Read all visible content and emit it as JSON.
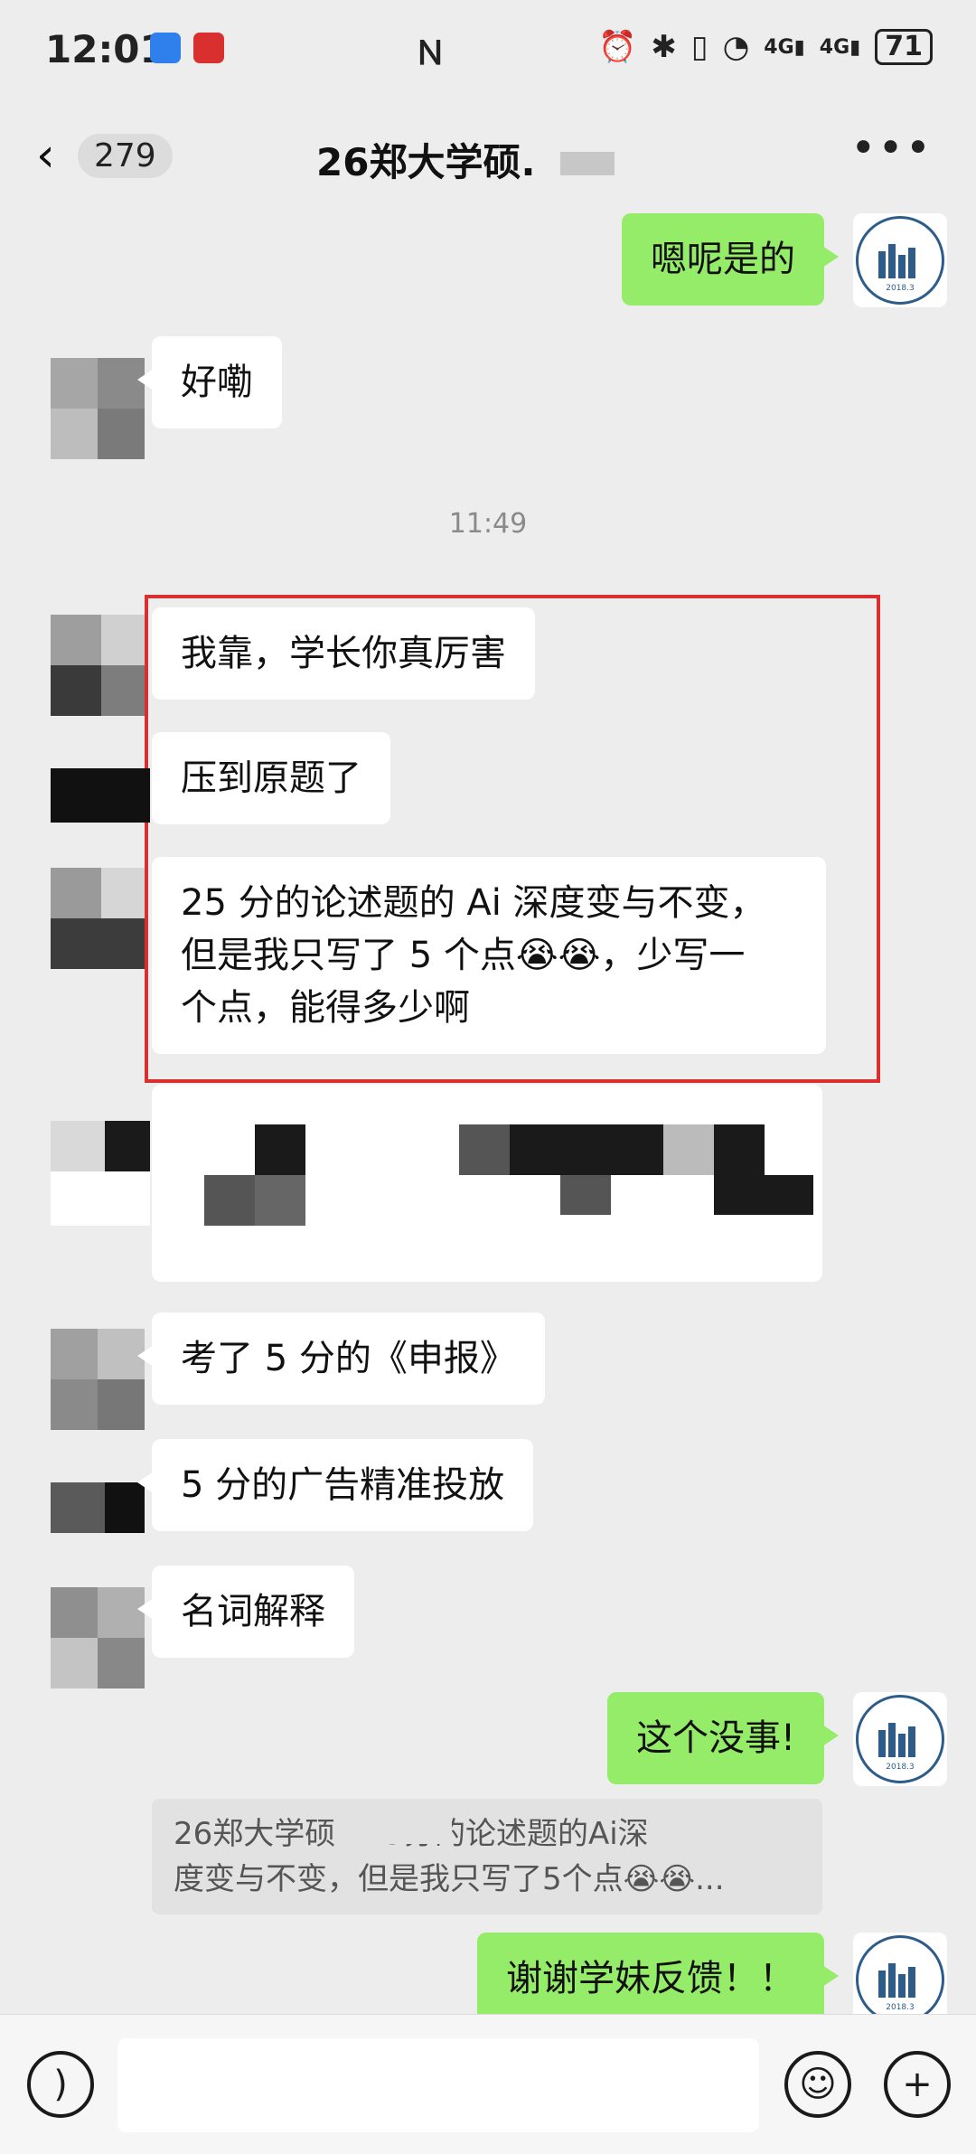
{
  "status": {
    "time": "12:01",
    "signal_labels": [
      "4G",
      "4G"
    ],
    "battery": "71"
  },
  "nav": {
    "unread_count": "279",
    "title": "26郑大学硕."
  },
  "messages": {
    "m1": "嗯呢是的",
    "m2": "好嘞",
    "timestamp": "11:49",
    "m3": "我靠，学长你真厉害",
    "m4": "压到原题了",
    "m5_line1": "25 分的论述题的 Ai 深度变与不变，",
    "m5_line2": "但是我只写了 5 个点😭😭，少写一",
    "m5_line3": "个点，能得多少啊",
    "m7": "考了 5 分的《申报》",
    "m8": "5 分的广告精准投放",
    "m9": "名词解释",
    "m10": "这个没事!",
    "quote_line1": "26郑大学硕              .  25分的论述题的Ai深",
    "quote_line2": "度变与不变，但是我只写了5个点😭😭...",
    "m11": "谢谢学妹反馈！！"
  },
  "colors": {
    "self_bubble": "#95ec69",
    "other_bubble": "#ffffff",
    "highlight_box": "#d9302f",
    "background": "#ededed"
  },
  "icons": [
    "back-chevron-icon",
    "more-dots-icon",
    "voice-icon",
    "emoji-icon",
    "plus-icon",
    "nfc-icon",
    "alarm-icon",
    "bluetooth-icon",
    "vibrate-icon",
    "wifi-icon"
  ]
}
